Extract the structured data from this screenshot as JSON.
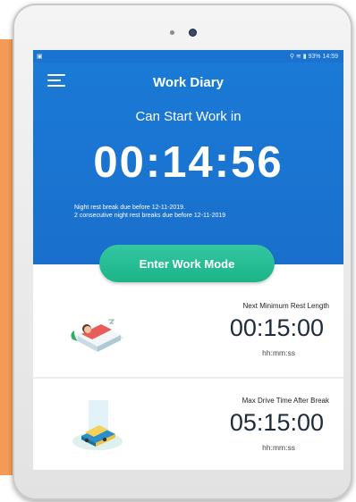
{
  "status_bar": {
    "right_text": "93% 14:59"
  },
  "app_bar": {
    "title": "Work Diary"
  },
  "hero": {
    "heading": "Can Start Work in",
    "countdown": "00:14:56",
    "notice_line1": "Night rest break due before 12-11-2019.",
    "notice_line2": "2 consecutive night rest breaks due before 12-11-2019"
  },
  "actions": {
    "enter_work_mode": "Enter Work Mode"
  },
  "cards": [
    {
      "label": "Next Minimum Rest Length",
      "value": "00:15:00",
      "unit": "hh:mm:ss",
      "icon": "bed-rest-icon"
    },
    {
      "label": "Max Drive Time After Break",
      "value": "05:15:00",
      "unit": "hh:mm:ss",
      "icon": "truck-icon"
    }
  ],
  "colors": {
    "header_blue": "#1a74cf",
    "button_green": "#26bd95",
    "accent_orange": "#f59a56"
  }
}
